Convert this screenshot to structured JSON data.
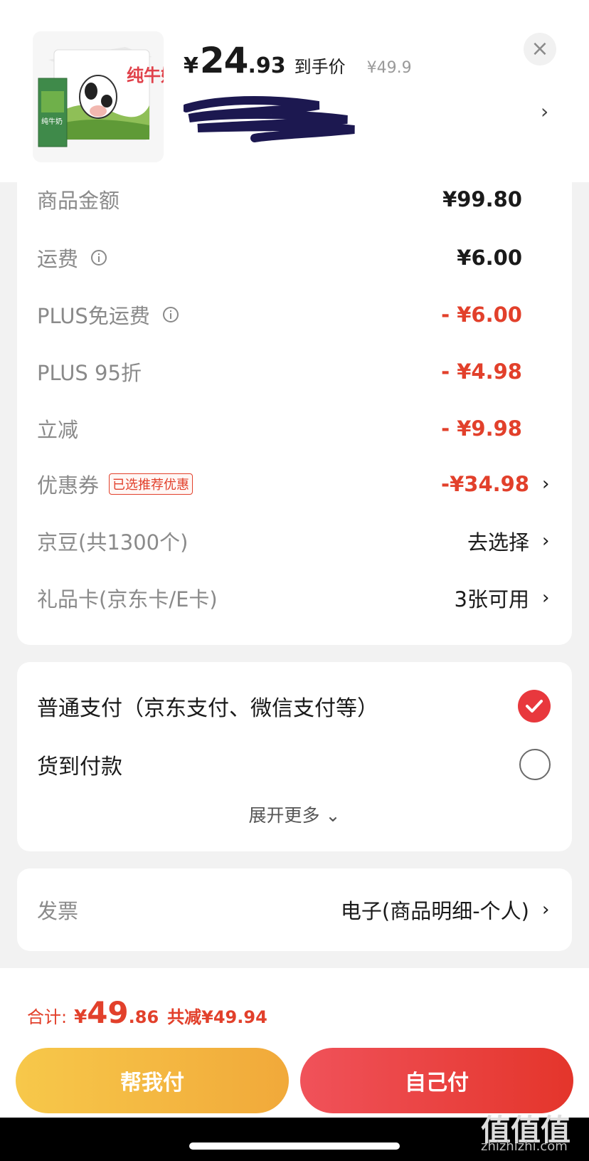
{
  "header": {
    "price_yen": "¥",
    "price_int": "24",
    "price_dec": ".93",
    "price_label": "到手价",
    "original_price": "¥49.9",
    "close_icon": "×",
    "chevron": "›"
  },
  "details": [
    {
      "label": "商品金额",
      "value": "¥99.80",
      "info": false,
      "color": "#1a1a1a"
    },
    {
      "label": "运费",
      "value": "¥6.00",
      "info": true,
      "color": "#1a1a1a"
    },
    {
      "label": "PLUS免运费",
      "value": "- ¥6.00",
      "info": true,
      "color": "#e2402b"
    },
    {
      "label": "PLUS 95折",
      "value": "- ¥4.98",
      "info": false,
      "color": "#e2402b"
    },
    {
      "label": "立减",
      "value": "- ¥9.98",
      "info": false,
      "color": "#e2402b"
    },
    {
      "label": "优惠券",
      "tag": "已选推荐优惠",
      "value": "-¥34.98",
      "color": "#e2402b",
      "chevron": "›"
    },
    {
      "label": "京豆(共1300个)",
      "value": "去选择",
      "chevron": "›"
    },
    {
      "label": "礼品卡(京东卡/E卡)",
      "value": "3张可用",
      "chevron": "›"
    }
  ],
  "payment": {
    "options": [
      {
        "label": "普通支付（京东支付、微信支付等）",
        "selected": true
      },
      {
        "label": "货到付款",
        "selected": false
      }
    ],
    "more": "展开更多",
    "more_icon": "⌄"
  },
  "invoice": {
    "label": "发票",
    "value": "电子(商品明细-个人)",
    "chevron": "›"
  },
  "total": {
    "label": "合计:",
    "yen": "¥",
    "int": "49",
    "dec": ".86",
    "saved": "共减¥49.94"
  },
  "buttons": {
    "help_pay": "帮我付",
    "self_pay": "自己付"
  },
  "watermark": {
    "mark": "值值值",
    "url": "zhizhizhi.com"
  },
  "colors": {
    "accent_red": "#e2402b",
    "yellow_button": "#f1a93a",
    "red_button": "#e4352b"
  }
}
